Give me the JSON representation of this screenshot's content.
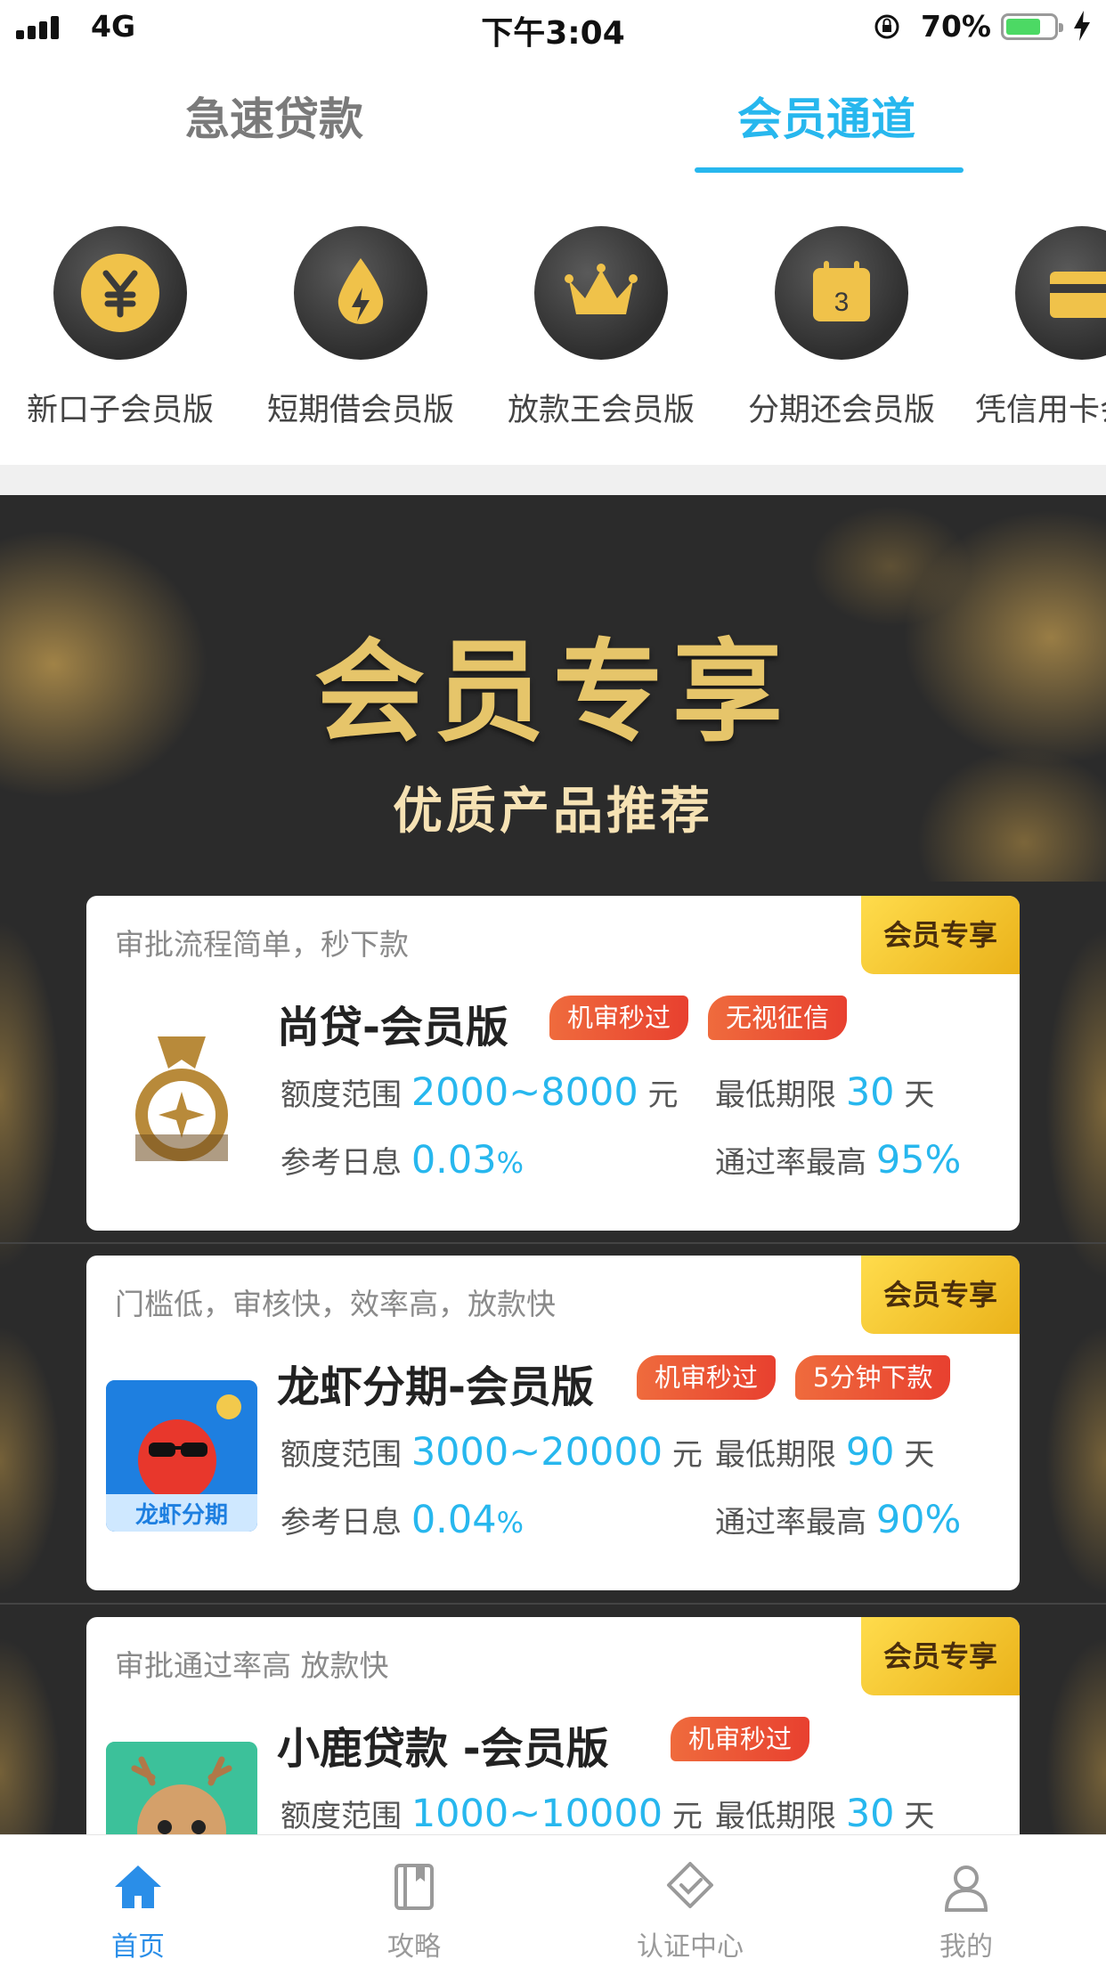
{
  "status_bar": {
    "network": "4G",
    "time": "下午3:04",
    "battery_pct": "70%",
    "battery_level": 0.7
  },
  "tabs": [
    {
      "label": "急速贷款",
      "active": false
    },
    {
      "label": "会员通道",
      "active": true
    }
  ],
  "categories": [
    {
      "label": "新口子会员版",
      "icon": "yuan-coin-icon"
    },
    {
      "label": "短期借会员版",
      "icon": "lightning-drop-icon"
    },
    {
      "label": "放款王会员版",
      "icon": "crown-icon"
    },
    {
      "label": "分期还会员版",
      "icon": "calendar-icon",
      "icon_text": "3"
    },
    {
      "label": "凭信用卡会员版",
      "icon": "credit-card-icon"
    }
  ],
  "banner": {
    "title": "会员专享",
    "subtitle": "优质产品推荐"
  },
  "products": [
    {
      "slogan": "审批流程简单，秒下款",
      "badge": "会员专享",
      "name": "尚贷-会员版",
      "tags": [
        "机审秒过",
        "无视征信"
      ],
      "amount_label": "额度范围",
      "amount": "2000~8000",
      "amount_unit": "元",
      "term_label": "最低期限",
      "term": "30",
      "term_unit": "天",
      "rate_label": "参考日息",
      "rate": "0.03",
      "rate_unit": "%",
      "pass_label": "通过率最高",
      "pass": "95%"
    },
    {
      "slogan": "门槛低，审核快，效率高，放款快",
      "badge": "会员专享",
      "name": "龙虾分期-会员版",
      "logo_text": "龙虾分期",
      "tags": [
        "机审秒过",
        "5分钟下款"
      ],
      "amount_label": "额度范围",
      "amount": "3000~20000",
      "amount_unit": "元",
      "term_label": "最低期限",
      "term": "90",
      "term_unit": "天",
      "rate_label": "参考日息",
      "rate": "0.04",
      "rate_unit": "%",
      "pass_label": "通过率最高",
      "pass": "90%"
    },
    {
      "slogan": "审批通过率高 放款快",
      "badge": "会员专享",
      "name": "小鹿贷款  -会员版",
      "tags": [
        "机审秒过"
      ],
      "amount_label": "额度范围",
      "amount": "1000~10000",
      "amount_unit": "元",
      "term_label": "最低期限",
      "term": "30",
      "term_unit": "天"
    }
  ],
  "bottom_nav": [
    {
      "label": "首页",
      "icon": "home-icon",
      "active": true
    },
    {
      "label": "攻略",
      "icon": "book-icon",
      "active": false
    },
    {
      "label": "认证中心",
      "icon": "shield-check-icon",
      "active": false
    },
    {
      "label": "我的",
      "icon": "person-icon",
      "active": false
    }
  ],
  "colors": {
    "accent": "#27b7ee",
    "gold": "#e6c56a",
    "tag": "#e8402f",
    "nav_active": "#2a8ee8"
  }
}
